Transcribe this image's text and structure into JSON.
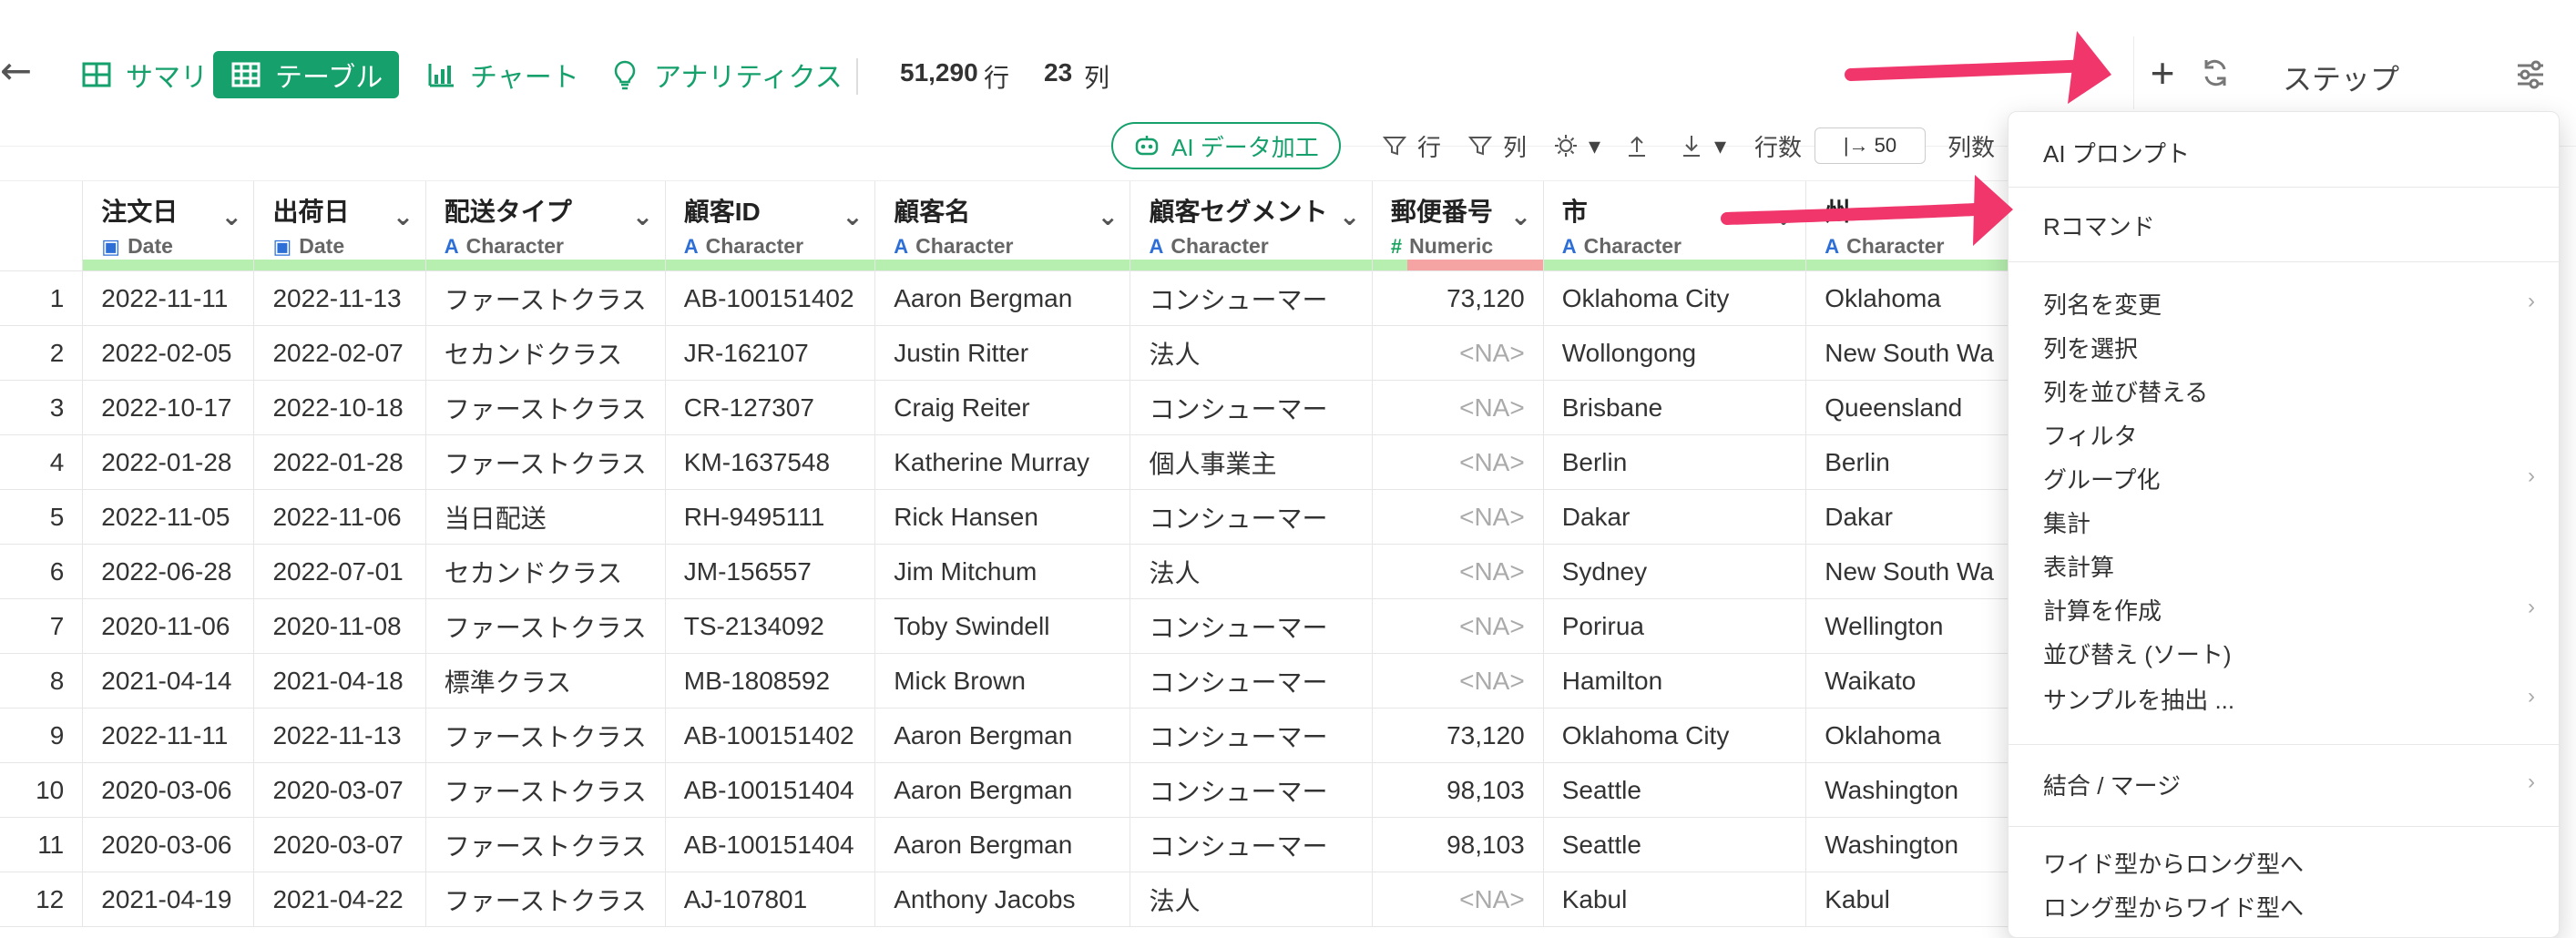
{
  "toolbar": {
    "tabs": [
      {
        "label": "サマリ",
        "icon": "table-grid-icon"
      },
      {
        "label": "テーブル",
        "icon": "table-grid-icon"
      },
      {
        "label": "チャート",
        "icon": "bar-chart-icon"
      },
      {
        "label": "アナリティクス",
        "icon": "lightbulb-icon"
      }
    ],
    "rows_count": "51,290",
    "rows_unit": "行",
    "cols_count": "23",
    "cols_unit": "列",
    "step_title": "ステップ"
  },
  "subtoolbar": {
    "ai_label": "AI データ加工",
    "row_filter_label": "行",
    "col_filter_label": "列",
    "rows_label": "行数",
    "rows_value": "|→ 50",
    "cols_label": "列数"
  },
  "table": {
    "columns": [
      {
        "name": "注文日",
        "type": "Date",
        "icon": "calendar-icon"
      },
      {
        "name": "出荷日",
        "type": "Date",
        "icon": "calendar-icon"
      },
      {
        "name": "配送タイプ",
        "type": "Character",
        "icon": "character-icon"
      },
      {
        "name": "顧客ID",
        "type": "Character",
        "icon": "character-icon"
      },
      {
        "name": "顧客名",
        "type": "Character",
        "icon": "character-icon"
      },
      {
        "name": "顧客セグメント",
        "type": "Character",
        "icon": "character-icon"
      },
      {
        "name": "郵便番号",
        "type": "Numeric",
        "icon": "numeric-icon"
      },
      {
        "name": "市",
        "type": "Character",
        "icon": "character-icon"
      },
      {
        "name": "州",
        "type": "Character",
        "icon": "character-icon"
      }
    ],
    "rows": [
      [
        "1",
        "2022-11-11",
        "2022-11-13",
        "ファーストクラス",
        "AB-100151402",
        "Aaron Bergman",
        "コンシューマー",
        "73,120",
        "Oklahoma City",
        "Oklahoma"
      ],
      [
        "2",
        "2022-02-05",
        "2022-02-07",
        "セカンドクラス",
        "JR-162107",
        "Justin Ritter",
        "法人",
        "<NA>",
        "Wollongong",
        "New South Wa"
      ],
      [
        "3",
        "2022-10-17",
        "2022-10-18",
        "ファーストクラス",
        "CR-127307",
        "Craig Reiter",
        "コンシューマー",
        "<NA>",
        "Brisbane",
        "Queensland"
      ],
      [
        "4",
        "2022-01-28",
        "2022-01-28",
        "ファーストクラス",
        "KM-1637548",
        "Katherine Murray",
        "個人事業主",
        "<NA>",
        "Berlin",
        "Berlin"
      ],
      [
        "5",
        "2022-11-05",
        "2022-11-06",
        "当日配送",
        "RH-9495111",
        "Rick Hansen",
        "コンシューマー",
        "<NA>",
        "Dakar",
        "Dakar"
      ],
      [
        "6",
        "2022-06-28",
        "2022-07-01",
        "セカンドクラス",
        "JM-156557",
        "Jim Mitchum",
        "法人",
        "<NA>",
        "Sydney",
        "New South Wa"
      ],
      [
        "7",
        "2020-11-06",
        "2020-11-08",
        "ファーストクラス",
        "TS-2134092",
        "Toby Swindell",
        "コンシューマー",
        "<NA>",
        "Porirua",
        "Wellington"
      ],
      [
        "8",
        "2021-04-14",
        "2021-04-18",
        "標準クラス",
        "MB-1808592",
        "Mick Brown",
        "コンシューマー",
        "<NA>",
        "Hamilton",
        "Waikato"
      ],
      [
        "9",
        "2022-11-11",
        "2022-11-13",
        "ファーストクラス",
        "AB-100151402",
        "Aaron Bergman",
        "コンシューマー",
        "73,120",
        "Oklahoma City",
        "Oklahoma"
      ],
      [
        "10",
        "2020-03-06",
        "2020-03-07",
        "ファーストクラス",
        "AB-100151404",
        "Aaron Bergman",
        "コンシューマー",
        "98,103",
        "Seattle",
        "Washington"
      ],
      [
        "11",
        "2020-03-06",
        "2020-03-07",
        "ファーストクラス",
        "AB-100151404",
        "Aaron Bergman",
        "コンシューマー",
        "98,103",
        "Seattle",
        "Washington"
      ],
      [
        "12",
        "2021-04-19",
        "2021-04-22",
        "ファーストクラス",
        "AJ-107801",
        "Anthony Jacobs",
        "法人",
        "<NA>",
        "Kabul",
        "Kabul"
      ]
    ]
  },
  "menu": {
    "items": [
      {
        "label": "AI プロンプト",
        "submenu": false
      },
      {
        "label": "Rコマンド",
        "submenu": false
      },
      {
        "label": "列名を変更",
        "submenu": true
      },
      {
        "label": "列を選択",
        "submenu": false
      },
      {
        "label": "列を並び替える",
        "submenu": false
      },
      {
        "label": "フィルタ",
        "submenu": false
      },
      {
        "label": "グループ化",
        "submenu": true
      },
      {
        "label": "集計",
        "submenu": false
      },
      {
        "label": "表計算",
        "submenu": false
      },
      {
        "label": "計算を作成",
        "submenu": true
      },
      {
        "label": "並び替え (ソート)",
        "submenu": false
      },
      {
        "label": "サンプルを抽出 ...",
        "submenu": true
      },
      {
        "label": "結合 / マージ",
        "submenu": true
      },
      {
        "label": "ワイド型からロング型へ",
        "submenu": false
      },
      {
        "label": "ロング型からワイド型へ",
        "submenu": false
      }
    ]
  },
  "colors": {
    "accent": "#16a06c",
    "annotation_arrow": "#f0366b"
  }
}
